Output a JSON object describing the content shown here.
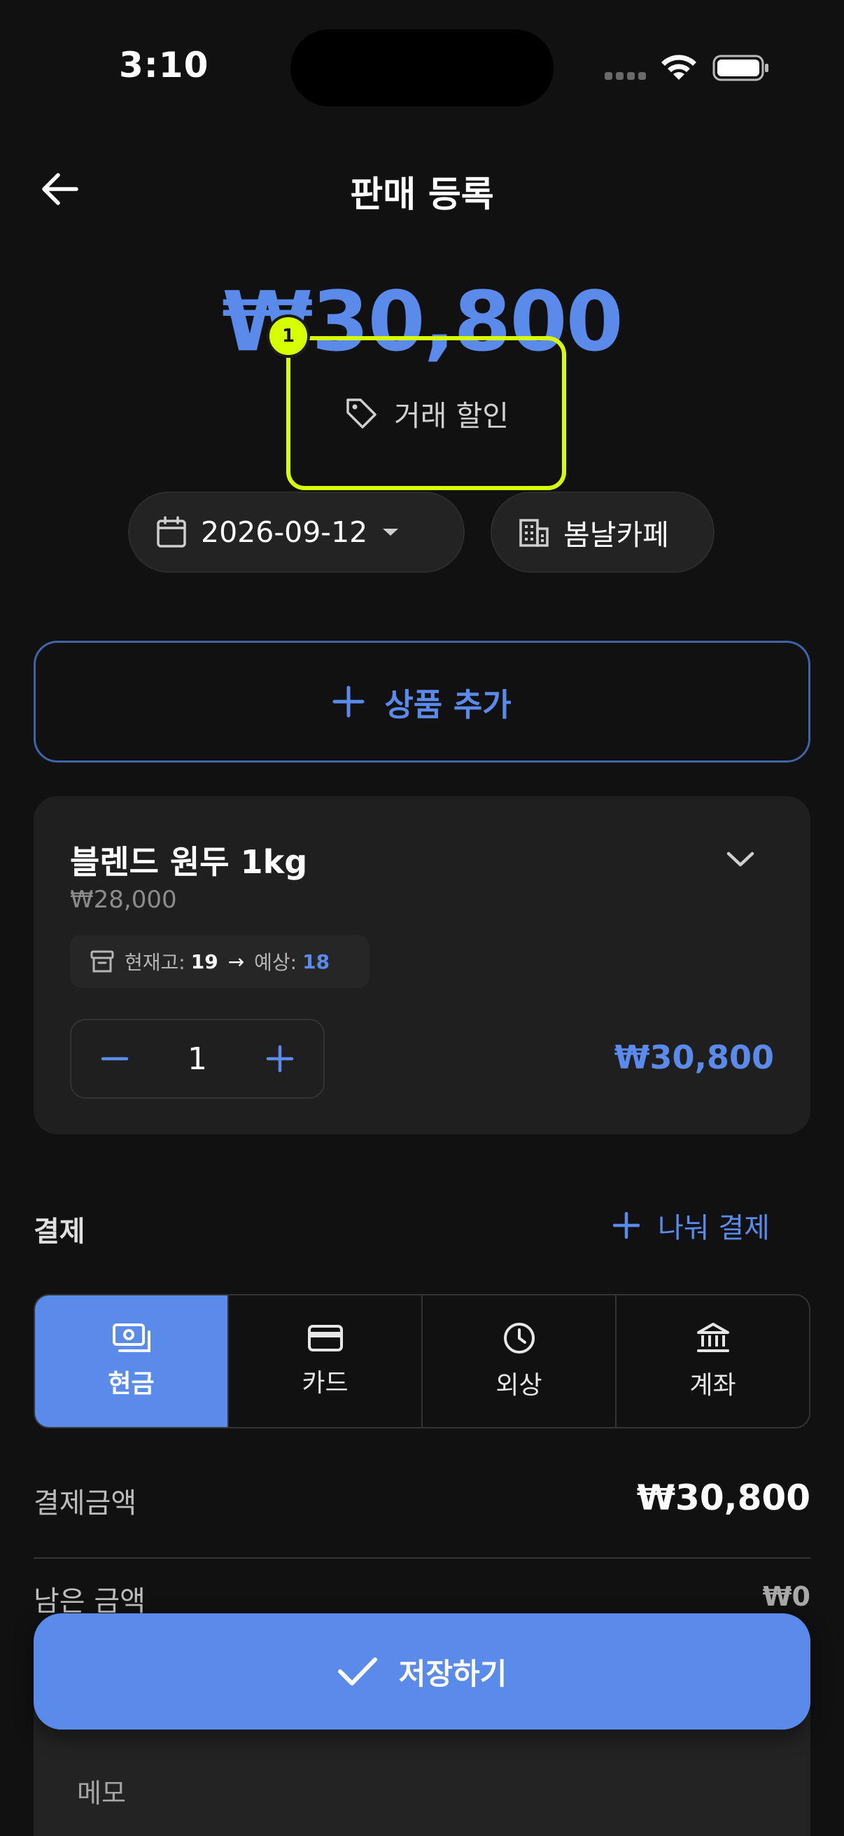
{
  "status_bar": {
    "time": "3:10"
  },
  "header": {
    "title": "판매 등록",
    "back_icon": "arrow-left-icon"
  },
  "total": {
    "amount": "₩30,800"
  },
  "discount": {
    "label": "거래 할인",
    "icon": "tag-icon",
    "badge": "1"
  },
  "date_chip": {
    "value": "2026-09-12",
    "icon": "calendar-icon"
  },
  "store_chip": {
    "value": "봄날카페",
    "icon": "building-icon"
  },
  "add_product": {
    "label": "상품 추가"
  },
  "product": {
    "name": "블렌드 원두 1kg",
    "unit_price": "₩28,000",
    "stock_label": "현재고:",
    "stock_current": "19",
    "arrow": "→",
    "expected_label": "예상:",
    "stock_expected": "18",
    "quantity": "1",
    "line_total": "₩30,800"
  },
  "payment": {
    "title": "결제",
    "split_label": "나눠 결제",
    "methods": [
      {
        "label": "현금",
        "icon": "cash-icon",
        "active": true
      },
      {
        "label": "카드",
        "icon": "card-icon",
        "active": false
      },
      {
        "label": "외상",
        "icon": "clock-icon",
        "active": false
      },
      {
        "label": "계좌",
        "icon": "bank-icon",
        "active": false
      }
    ],
    "amount_label": "결제금액",
    "amount_value": "₩30,800",
    "remaining_label": "남은 금액",
    "remaining_value": "₩0"
  },
  "save": {
    "label": "저장하기"
  },
  "memo": {
    "label": "메모"
  },
  "colors": {
    "accent": "#5b8bea",
    "highlight": "#d8ff00",
    "background": "#111111",
    "card": "#1f1f1f"
  }
}
